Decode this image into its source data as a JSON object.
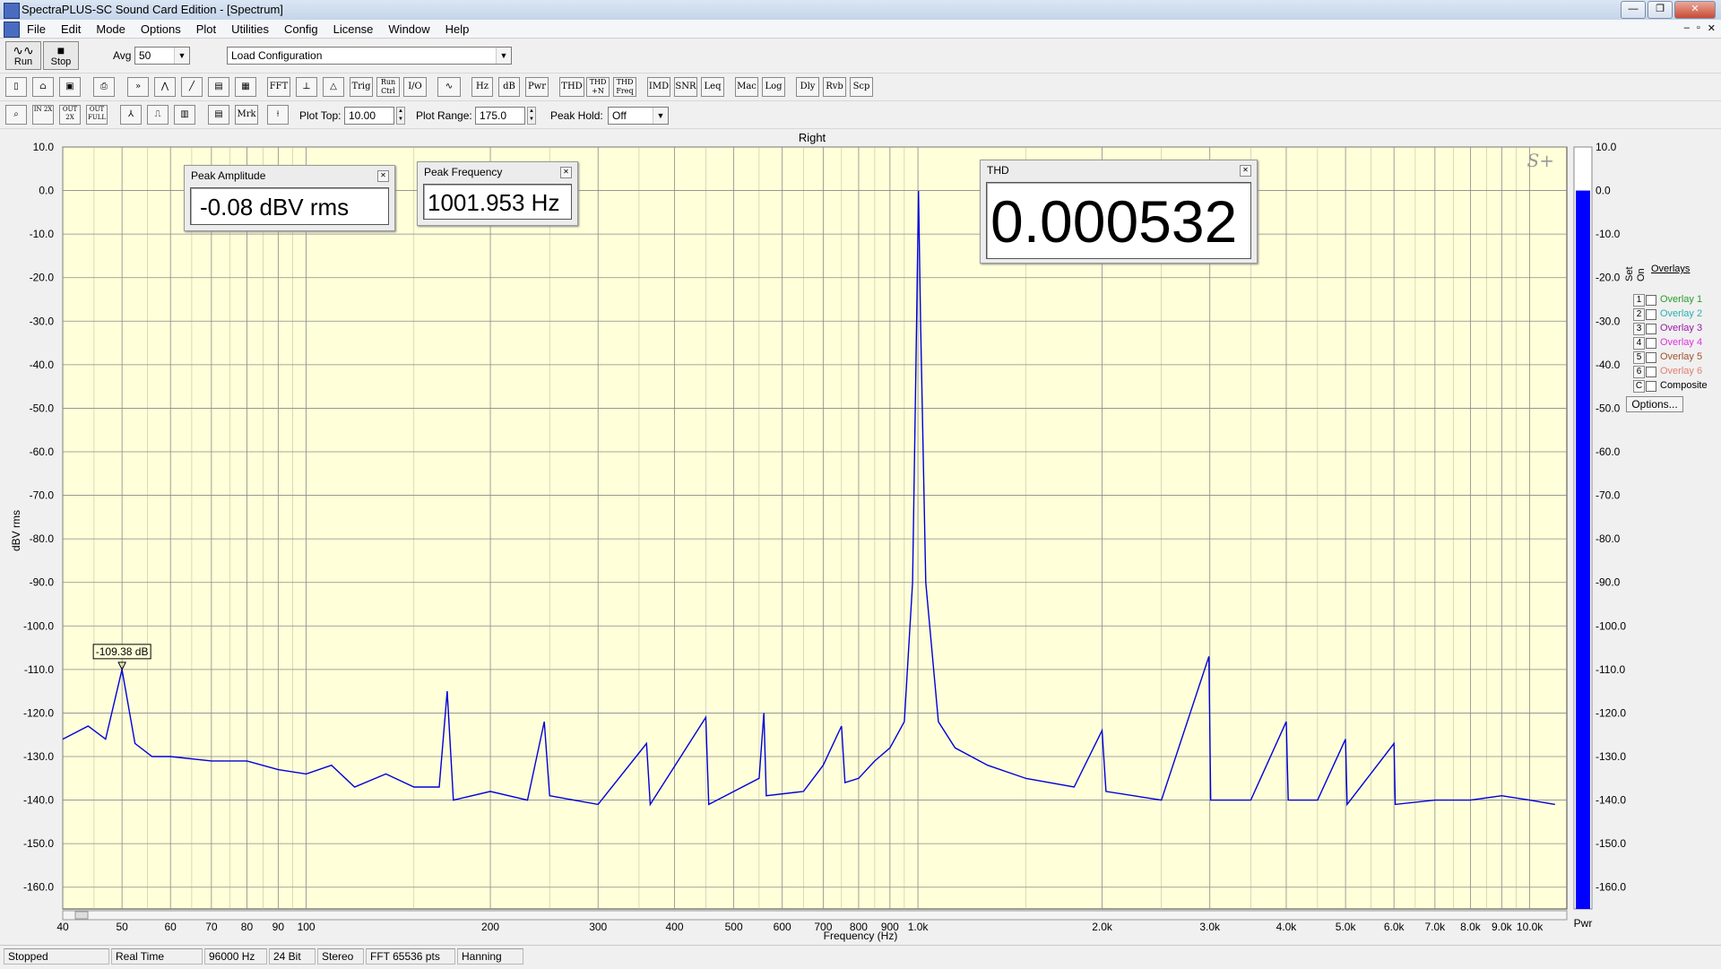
{
  "window": {
    "title": "SpectraPLUS-SC Sound Card Edition - [Spectrum]",
    "controls": [
      "—",
      "❐",
      "✕"
    ]
  },
  "menu": {
    "items": [
      "File",
      "Edit",
      "Mode",
      "Options",
      "Plot",
      "Utilities",
      "Config",
      "License",
      "Window",
      "Help"
    ],
    "mdi_controls": [
      "–",
      "▫",
      "✕"
    ]
  },
  "toolbar1": {
    "run_label": "Run",
    "stop_label": "Stop",
    "avg_label": "Avg",
    "avg_value": "50",
    "config_value": "Load Configuration"
  },
  "toolbar2": {
    "buttons": [
      "FFT",
      "Trig",
      "Run Ctrl",
      "I/O",
      "Hz",
      "dB",
      "Pwr",
      "THD",
      "THD +N",
      "THD Freq",
      "IMD",
      "SNR",
      "Leq",
      "Mac",
      "Log",
      "Dly",
      "Rvb",
      "Scp"
    ]
  },
  "toolbar3": {
    "zoom_buttons": [
      "IN 2X",
      "OUT 2X",
      "OUT FULL"
    ],
    "mrk_label": "Mrk",
    "plot_top_label": "Plot Top:",
    "plot_top_value": "10.00",
    "plot_range_label": "Plot Range:",
    "plot_range_value": "175.0",
    "peak_hold_label": "Peak Hold:",
    "peak_hold_value": "Off"
  },
  "plot": {
    "channel_title": "Right",
    "logo": "S+",
    "marker_label": "-109.38 dB",
    "bar_label": "Pwr"
  },
  "chart_data": {
    "type": "line",
    "title": "Right",
    "xlabel": "Frequency (Hz)",
    "ylabel": "dBV rms",
    "x_scale": "log",
    "xlim": [
      40,
      11500
    ],
    "ylim": [
      -165,
      10
    ],
    "grid": true,
    "background": "#ffffd9",
    "line_color": "#0000dd",
    "x_ticks": [
      {
        "v": 40,
        "l": "40"
      },
      {
        "v": 50,
        "l": "50"
      },
      {
        "v": 60,
        "l": "60"
      },
      {
        "v": 70,
        "l": "70"
      },
      {
        "v": 80,
        "l": "80"
      },
      {
        "v": 90,
        "l": "90"
      },
      {
        "v": 100,
        "l": "100"
      },
      {
        "v": 200,
        "l": "200"
      },
      {
        "v": 300,
        "l": "300"
      },
      {
        "v": 400,
        "l": "400"
      },
      {
        "v": 500,
        "l": "500"
      },
      {
        "v": 600,
        "l": "600"
      },
      {
        "v": 700,
        "l": "700"
      },
      {
        "v": 800,
        "l": "800"
      },
      {
        "v": 900,
        "l": "900"
      },
      {
        "v": 1000,
        "l": "1.0k"
      },
      {
        "v": 2000,
        "l": "2.0k"
      },
      {
        "v": 3000,
        "l": "3.0k"
      },
      {
        "v": 4000,
        "l": "4.0k"
      },
      {
        "v": 5000,
        "l": "5.0k"
      },
      {
        "v": 6000,
        "l": "6.0k"
      },
      {
        "v": 7000,
        "l": "7.0k"
      },
      {
        "v": 8000,
        "l": "8.0k"
      },
      {
        "v": 9000,
        "l": "9.0k"
      },
      {
        "v": 10000,
        "l": "10.0k"
      }
    ],
    "y_ticks": [
      10,
      0,
      -10,
      -20,
      -30,
      -40,
      -50,
      -60,
      -70,
      -80,
      -90,
      -100,
      -110,
      -120,
      -130,
      -140,
      -150,
      -160
    ],
    "series": [
      {
        "points": [
          [
            40,
            -126
          ],
          [
            44,
            -123
          ],
          [
            47,
            -126
          ],
          [
            50,
            -110
          ],
          [
            52.5,
            -127
          ],
          [
            56,
            -130
          ],
          [
            60,
            -130
          ],
          [
            70,
            -131
          ],
          [
            80,
            -131
          ],
          [
            90,
            -133
          ],
          [
            100,
            -134
          ],
          [
            110,
            -132
          ],
          [
            120,
            -137
          ],
          [
            135,
            -134
          ],
          [
            150,
            -137
          ],
          [
            165,
            -137
          ],
          [
            170,
            -115
          ],
          [
            174,
            -140
          ],
          [
            200,
            -138
          ],
          [
            230,
            -140
          ],
          [
            245,
            -122
          ],
          [
            250,
            -139
          ],
          [
            300,
            -141
          ],
          [
            360,
            -127
          ],
          [
            365,
            -141
          ],
          [
            450,
            -121
          ],
          [
            455,
            -141
          ],
          [
            550,
            -135
          ],
          [
            560,
            -120
          ],
          [
            565,
            -139
          ],
          [
            650,
            -138
          ],
          [
            700,
            -132
          ],
          [
            750,
            -123
          ],
          [
            760,
            -136
          ],
          [
            800,
            -135
          ],
          [
            850,
            -131
          ],
          [
            900,
            -128
          ],
          [
            950,
            -122
          ],
          [
            980,
            -90
          ],
          [
            995,
            -30
          ],
          [
            1002,
            -0.08
          ],
          [
            1010,
            -30
          ],
          [
            1030,
            -90
          ],
          [
            1080,
            -122
          ],
          [
            1150,
            -128
          ],
          [
            1300,
            -132
          ],
          [
            1500,
            -135
          ],
          [
            1800,
            -137
          ],
          [
            2000,
            -124
          ],
          [
            2030,
            -138
          ],
          [
            2500,
            -140
          ],
          [
            2990,
            -107
          ],
          [
            3010,
            -140
          ],
          [
            3500,
            -140
          ],
          [
            4000,
            -122
          ],
          [
            4030,
            -140
          ],
          [
            4500,
            -140
          ],
          [
            5000,
            -126
          ],
          [
            5030,
            -141
          ],
          [
            6000,
            -127
          ],
          [
            6030,
            -141
          ],
          [
            7000,
            -140
          ],
          [
            8000,
            -140
          ],
          [
            9000,
            -139
          ],
          [
            10000,
            -140
          ],
          [
            11000,
            -141
          ]
        ]
      }
    ],
    "power_bar": {
      "value": 0.0,
      "min": -165,
      "max": 10,
      "color": "#0000ff"
    }
  },
  "overlays": {
    "title": "Overlays",
    "set_label": "Set",
    "on_label": "On",
    "items": [
      {
        "num": "1",
        "label": "Overlay 1",
        "color": "#2a9d2a"
      },
      {
        "num": "2",
        "label": "Overlay 2",
        "color": "#2ab0b0"
      },
      {
        "num": "3",
        "label": "Overlay 3",
        "color": "#9a1aa8"
      },
      {
        "num": "4",
        "label": "Overlay 4",
        "color": "#e030e0"
      },
      {
        "num": "5",
        "label": "Overlay 5",
        "color": "#a0522d"
      },
      {
        "num": "6",
        "label": "Overlay 6",
        "color": "#e08070"
      },
      {
        "num": "C",
        "label": "Composite",
        "color": "#000000"
      }
    ],
    "options_label": "Options..."
  },
  "popups": {
    "peak_amplitude": {
      "title": "Peak Amplitude",
      "value": "-0.08 dBV rms"
    },
    "peak_frequency": {
      "title": "Peak Frequency",
      "value": "1001.953 Hz"
    },
    "thd": {
      "title": "THD",
      "value": "0.000532"
    }
  },
  "status": {
    "cells": [
      "Stopped",
      "Real Time",
      "96000 Hz",
      "24 Bit",
      "Stereo",
      "FFT 65536 pts",
      "Hanning"
    ]
  }
}
